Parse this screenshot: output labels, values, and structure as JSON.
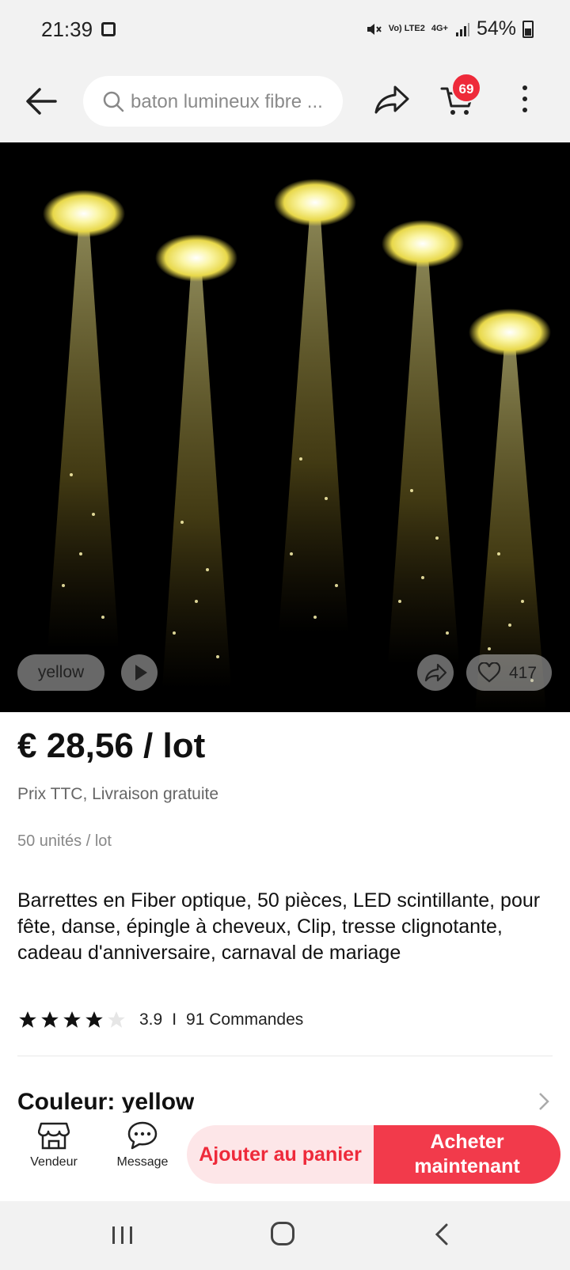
{
  "status_bar": {
    "time": "21:39",
    "network": "Vo) LTE2",
    "signal_type": "4G+",
    "battery": "54%"
  },
  "top_bar": {
    "search_text": "baton lumineux fibre ...",
    "cart_count": "69"
  },
  "gallery": {
    "variant_label": "yellow",
    "like_count": "417"
  },
  "product": {
    "price": "€ 28,56 / lot",
    "price_note": "Prix TTC, Livraison gratuite",
    "units": "50 unités / lot",
    "title": "Barrettes en Fiber optique, 50 pièces, LED scintillante, pour fête, danse, épingle à cheveux, Clip, tresse clignotante, cadeau d'anniversaire, carnaval de mariage",
    "rating": "3.9",
    "rating_separator": "I",
    "orders": "91 Commandes",
    "stars_filled": 4,
    "stars_total": 5,
    "color_label": "Couleur: yellow"
  },
  "bottom_bar": {
    "store_label": "Vendeur",
    "message_label": "Message",
    "add_to_cart_label": "Ajouter au panier",
    "buy_now_line1": "Acheter",
    "buy_now_line2": "maintenant"
  },
  "colors": {
    "accent_red": "#f23a4b",
    "badge_red": "#ee2a3a",
    "cart_pink": "#fde6e8",
    "glow_yellow": "#f6f08a"
  }
}
